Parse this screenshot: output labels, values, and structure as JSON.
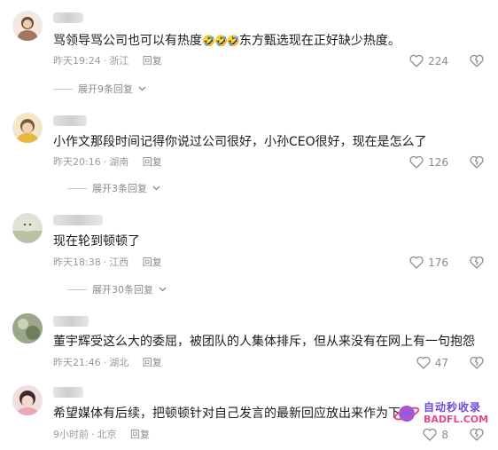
{
  "comments": [
    {
      "text": "骂领导骂公司也可以有热度",
      "emoji": "🤣🤣🤣",
      "text_after": "东方甄选现在正好缺少热度。",
      "time": "昨天19:24",
      "location": "浙江",
      "reply_label": "回复",
      "likes": "224",
      "expand_label": "展开9条回复"
    },
    {
      "text": "小作文那段时间记得你说过公司很好，小孙CEO很好，现在是怎么了",
      "time": "昨天20:16",
      "location": "湖南",
      "reply_label": "回复",
      "likes": "126",
      "expand_label": "展开3条回复"
    },
    {
      "text": "现在轮到顿顿了",
      "time": "昨天18:38",
      "location": "江西",
      "reply_label": "回复",
      "likes": "176",
      "expand_label": "展开30条回复"
    },
    {
      "text": "董宇辉受这么大的委屈，被团队的人集体排斥，但从来没有在网上有一句抱怨",
      "time": "昨天21:46",
      "location": "湖北",
      "reply_label": "回复",
      "likes": "47"
    },
    {
      "text": "希望媒体有后续，把顿顿针对自己发言的最新回应放出来作为下集",
      "time": "9小时前",
      "location": "北京",
      "reply_label": "回复",
      "likes": "8"
    }
  ],
  "watermark": {
    "cn": "自动秒收录",
    "en": "BADFL.COM"
  },
  "colors": {
    "text": "#1a1a1a",
    "meta": "#9a9a9a",
    "watermark_purple": "#6f4ad8",
    "watermark_pink": "#e24a8b"
  }
}
